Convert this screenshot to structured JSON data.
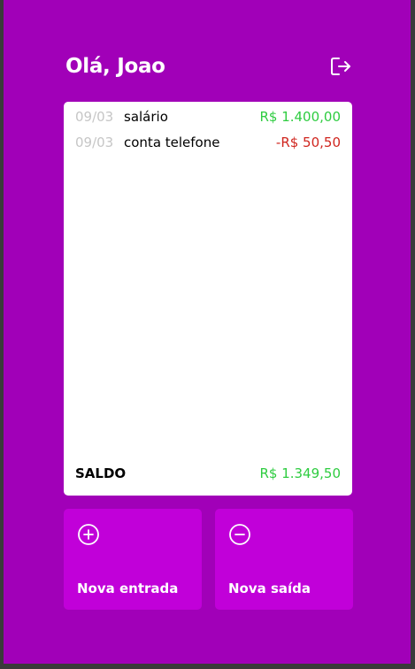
{
  "header": {
    "greeting": "Olá, Joao",
    "logout_icon": "logout-icon"
  },
  "records": [
    {
      "date": "09/03",
      "description": "salário",
      "value": "R$ 1.400,00",
      "type": "entrada"
    },
    {
      "date": "09/03",
      "description": "conta telefone",
      "value": "-R$ 50,50",
      "type": "saida"
    }
  ],
  "balance": {
    "label": "SALDO",
    "value": "R$ 1.349,50"
  },
  "actions": {
    "new_entry": {
      "label": "Nova entrada",
      "icon": "plus-circle-icon"
    },
    "new_exit": {
      "label": "Nova saída",
      "icon": "minus-circle-icon"
    }
  },
  "colors": {
    "background": "#a100b8",
    "button": "#c100d9",
    "positive": "#2ecc40",
    "negative": "#d0261f",
    "date": "#c6c6c6"
  }
}
